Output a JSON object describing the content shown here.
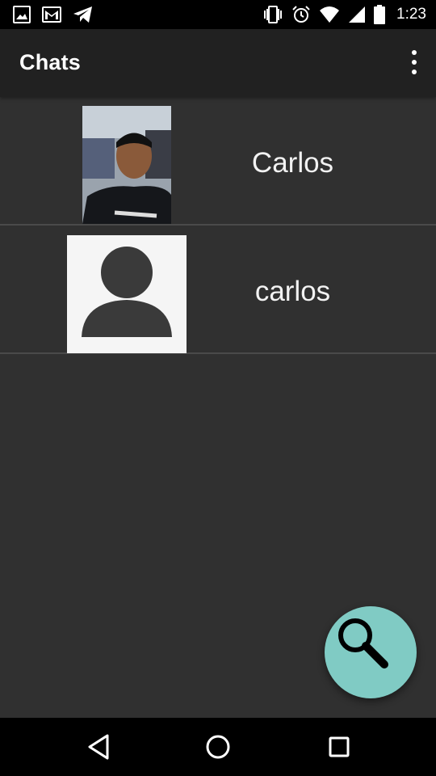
{
  "status_bar": {
    "time": "1:23",
    "left_icons": [
      "image-icon",
      "gmail-icon",
      "telegram-icon"
    ],
    "right_icons": [
      "vibrate-icon",
      "alarm-icon",
      "wifi-icon",
      "signal-icon",
      "battery-icon"
    ]
  },
  "app_bar": {
    "title": "Chats",
    "overflow_icon": "more-vert-icon"
  },
  "chats": [
    {
      "name": "Carlos",
      "avatar": "photo"
    },
    {
      "name": "carlos",
      "avatar": "default-person-icon"
    }
  ],
  "fab": {
    "icon": "search-icon",
    "color": "#80cbc4"
  },
  "nav_bar": {
    "icons": [
      "back-icon",
      "home-icon",
      "recents-icon"
    ]
  },
  "colors": {
    "background": "#303030",
    "app_bar": "#212121",
    "status_bar": "#000000",
    "divider": "#4a4a4a",
    "accent": "#80cbc4"
  }
}
